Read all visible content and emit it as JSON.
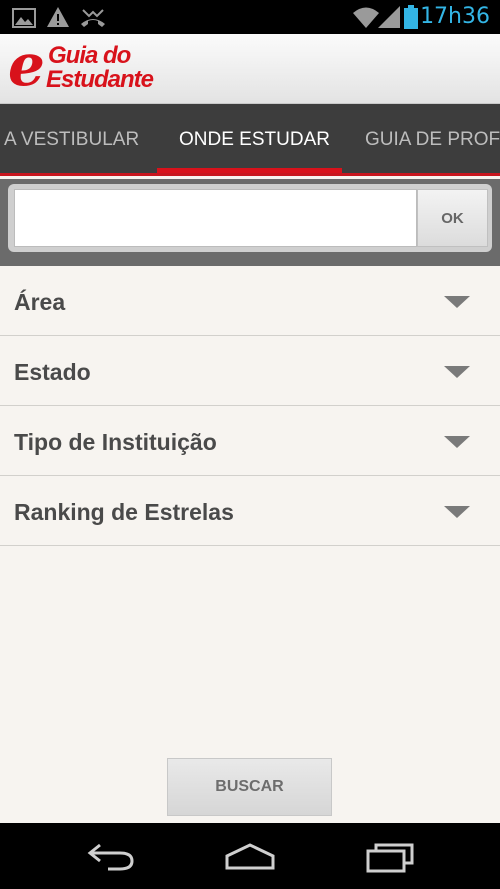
{
  "status_bar": {
    "time": "17h36",
    "icons": [
      "image-icon",
      "warning-icon",
      "missed-call-icon",
      "wifi-icon",
      "signal-icon",
      "battery-icon"
    ],
    "time_color": "#33b5e5"
  },
  "header": {
    "logo_mark": "e",
    "logo_line1": "Guia do",
    "logo_line2": "Estudante",
    "brand_color": "#d8121b"
  },
  "tabs": [
    {
      "label": "A VESTIBULAR",
      "active": false
    },
    {
      "label": "ONDE ESTUDAR",
      "active": true
    },
    {
      "label": "GUIA DE PROFI",
      "active": false
    }
  ],
  "search": {
    "value": "",
    "placeholder": "",
    "ok_label": "OK"
  },
  "filters": [
    {
      "label": "Área",
      "icon": "dropdown-arrow-icon"
    },
    {
      "label": "Estado",
      "icon": "dropdown-arrow-icon"
    },
    {
      "label": "Tipo de Instituição",
      "icon": "dropdown-arrow-icon"
    },
    {
      "label": "Ranking de Estrelas",
      "icon": "dropdown-arrow-icon"
    }
  ],
  "buscar_label": "BUSCAR",
  "nav_bar": {
    "icons": [
      "back-icon",
      "home-icon",
      "recent-apps-icon"
    ]
  }
}
